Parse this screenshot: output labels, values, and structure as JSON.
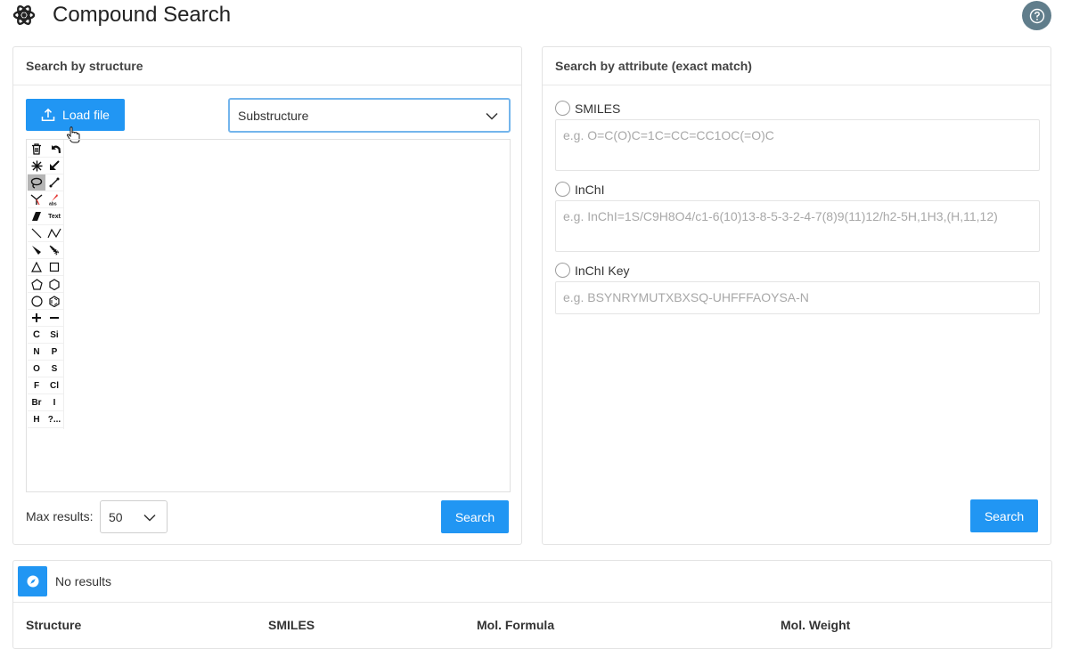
{
  "header": {
    "title": "Compound Search",
    "logo_icon": "atom-gear-icon",
    "help_icon": "help-circle-icon"
  },
  "structure_panel": {
    "title": "Search by structure",
    "load_button": "Load file",
    "search_type": "Substructure",
    "toolbar": {
      "text_tool": "Text",
      "elements": [
        "C",
        "Si",
        "N",
        "P",
        "O",
        "S",
        "F",
        "Cl",
        "Br",
        "I",
        "H",
        "?..."
      ]
    },
    "max_results_label": "Max results:",
    "max_results_value": "50",
    "search_button": "Search"
  },
  "attribute_panel": {
    "title": "Search by attribute (exact match)",
    "fields": [
      {
        "label": "SMILES",
        "placeholder": "e.g. O=C(O)C=1C=CC=CC1OC(=O)C"
      },
      {
        "label": "InChI",
        "placeholder": "e.g. InChI=1S/C9H8O4/c1-6(10)13-8-5-3-2-4-7(8)9(11)12/h2-5H,1H3,(H,11,12)"
      },
      {
        "label": "InChI Key",
        "placeholder": "e.g. BSYNRYMUTXBXSQ-UHFFFAOYSA-N"
      }
    ],
    "search_button": "Search"
  },
  "results": {
    "status": "No results",
    "columns": [
      "Structure",
      "SMILES",
      "Mol. Formula",
      "Mol. Weight"
    ]
  },
  "colors": {
    "accent": "#2196f3",
    "help_bg": "#607d8b"
  }
}
